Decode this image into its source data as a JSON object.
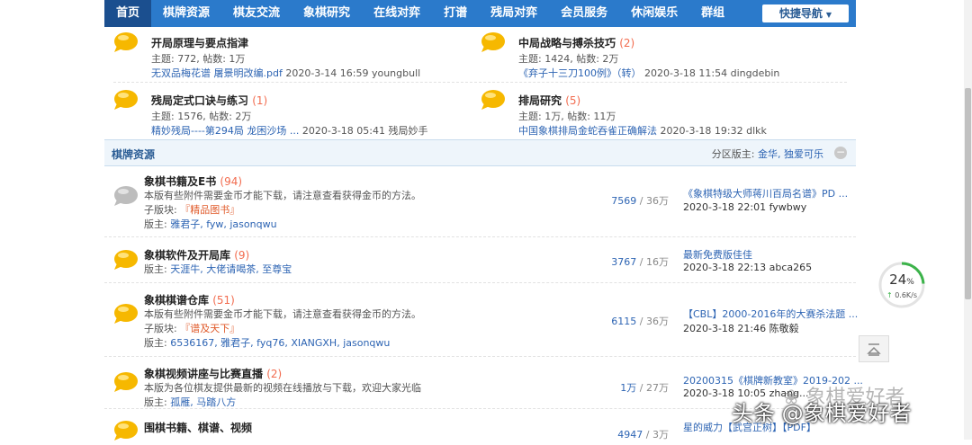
{
  "nav": {
    "items": [
      "首页",
      "棋牌资源",
      "棋友交流",
      "象棋研究",
      "在线对弈",
      "打谱",
      "残局对弈",
      "会员服务",
      "休闲娱乐",
      "群组"
    ],
    "quick_nav": "快捷导航"
  },
  "top_forums": [
    {
      "title": "开局原理与要点指津",
      "count": "",
      "stats": "主题: 772, 帖数: 1万",
      "last_link": "无双品梅花谱 屠景明改编.pdf",
      "last_meta": "2020-3-14 16:59 youngbull"
    },
    {
      "title": "中局战略与搏杀技巧",
      "count": "(2)",
      "stats": "主题: 1424, 帖数: 2万",
      "last_link": "《弃子十三刀100例》（转）",
      "last_meta": "2020-3-18 11:54 dingdebin"
    },
    {
      "title": "残局定式口诀与练习",
      "count": "(1)",
      "stats": "主题: 1576, 帖数: 2万",
      "last_link": "精妙残局----第294局 龙困沙场 ...",
      "last_meta": "2020-3-18 05:41 残局妙手"
    },
    {
      "title": "排局研究",
      "count": "(5)",
      "stats": "主题: 1万, 帖数: 11万",
      "last_link": "中国象棋排局金蛇吞雀正确解法",
      "last_meta": "2020-3-18 19:32 dlkk"
    }
  ],
  "section": {
    "title": "棋牌资源",
    "mods_label": "分区版主: ",
    "mods": "金华, 独爱可乐"
  },
  "forums": [
    {
      "title": "象棋书籍及E书",
      "count": "(94)",
      "desc": "本版有些附件需要金币才能下载，请注意查看获得金币的方法。",
      "sub_label": "子版块: ",
      "sub": "『精品图书』",
      "mod_label": "版主: ",
      "mods": "雅君子, fyw, jasonqwu",
      "threads": "7569",
      "posts": "36万",
      "last_title": "《象棋特级大师蒋川百局名谱》PD ...",
      "last_meta": "2020-3-18 22:01 fywbwy",
      "icon": "gray"
    },
    {
      "title": "象棋软件及开局库",
      "count": "(9)",
      "desc": "",
      "sub_label": "",
      "sub": "",
      "mod_label": "版主: ",
      "mods": "天涯牛, 大佬请喝茶, 至尊宝",
      "threads": "3767",
      "posts": "16万",
      "last_title": "最新免费版佳佳",
      "last_meta": "2020-3-18 22:13 abca265",
      "icon": "yellow"
    },
    {
      "title": "象棋棋谱仓库",
      "count": "(51)",
      "desc": "本版有些附件需要金币才能下载，请注意查看获得金币的方法。",
      "sub_label": "子版块: ",
      "sub": "『谱及天下』",
      "mod_label": "版主: ",
      "mods": "6536167, 雅君子, fyq76, XIANGXH, jasonqwu",
      "threads": "6115",
      "posts": "36万",
      "last_title": "【CBL】2000-2016年的大赛杀法题 ...",
      "last_meta": "2020-3-18 21:46 陈敬毅",
      "icon": "yellow"
    },
    {
      "title": "象棋视频讲座与比赛直播",
      "count": "(2)",
      "desc": "本版为各位棋友提供最新的视频在线播放与下载，欢迎大家光临",
      "sub_label": "",
      "sub": "",
      "mod_label": "版主: ",
      "mods": "孤雁, 马踏八方",
      "threads": "1万",
      "posts": "27万",
      "last_title": "20200315《棋牌新教室》2019-202 ...",
      "last_meta": "2020-3-18 10:05 zhang...",
      "icon": "yellow"
    },
    {
      "title": "围棋书籍、棋谱、视频",
      "count": "",
      "desc": "",
      "sub_label": "",
      "sub": "",
      "mod_label": "",
      "mods": "",
      "threads": "4947",
      "posts": "3万",
      "last_title": "星的威力【武宫正树】【PDF】",
      "last_meta": "",
      "icon": "yellow"
    }
  ],
  "speed": {
    "percent": "24",
    "unit": "%",
    "rate": "0.6K/s"
  },
  "watermark": {
    "main": "头条 @象棋爱好者",
    "sub": "象棋爱好者"
  }
}
